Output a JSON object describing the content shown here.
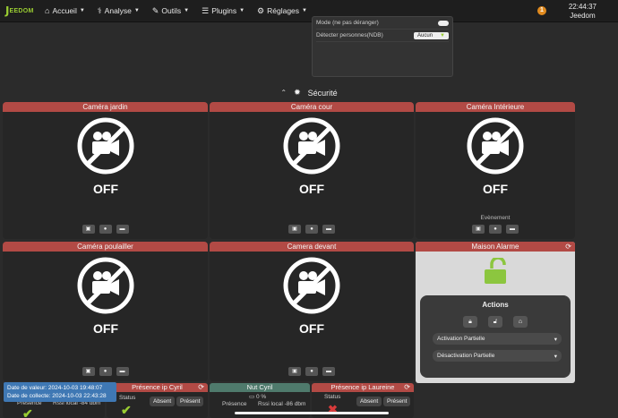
{
  "nav": {
    "logo_text": "EEDOM",
    "items": [
      {
        "label": "Accueil",
        "icon": "home-icon"
      },
      {
        "label": "Analyse",
        "icon": "analysis-icon"
      },
      {
        "label": "Outils",
        "icon": "wrench-icon"
      },
      {
        "label": "Plugins",
        "icon": "list-icon"
      },
      {
        "label": "Réglages",
        "icon": "gear-icon"
      }
    ],
    "notif_count": "1",
    "time": "22:44:37",
    "user": "Jeedom"
  },
  "panel": {
    "row1_label": "Mode (ne pas déranger)",
    "row2_label": "Détecter personnes(NDB)",
    "row2_value": "Aucun"
  },
  "section": {
    "title": "Sécurité"
  },
  "cameras": [
    {
      "title": "Caméra jardin",
      "state": "OFF"
    },
    {
      "title": "Caméra cour",
      "state": "OFF"
    },
    {
      "title": "Caméra Intérieure",
      "state": "OFF",
      "event_label": "Evènement"
    },
    {
      "title": "Caméra poulailler",
      "state": "OFF"
    },
    {
      "title": "Camera devant",
      "state": "OFF"
    }
  ],
  "alarm": {
    "title": "Maison Alarme",
    "actions_title": "Actions",
    "select1": "Activation Partielle",
    "select2": "Désactivation Partielle"
  },
  "bottom": {
    "presence_label": "Présence",
    "rssi_text": "Rssi local -84 dbm",
    "presence_cyril_title": "Présence ip Cyril",
    "status_label": "Status",
    "absent": "Absent",
    "present": "Présent",
    "nut_title": "Nut Cyril",
    "battery": "0 %",
    "nut_presence": "Présence",
    "nut_rssi": "Rssi local -86 dbm",
    "laureine_title": "Présence ip Laureine"
  },
  "tooltip": {
    "line1": "Date de valeur: 2024-10-03 19:48:07",
    "line2": "Date de collecte: 2024-10-03 22:43:28"
  },
  "colors": {
    "header_red": "#b24a45",
    "accent_green": "#9acd32",
    "nut_header": "#4f7a6c"
  }
}
